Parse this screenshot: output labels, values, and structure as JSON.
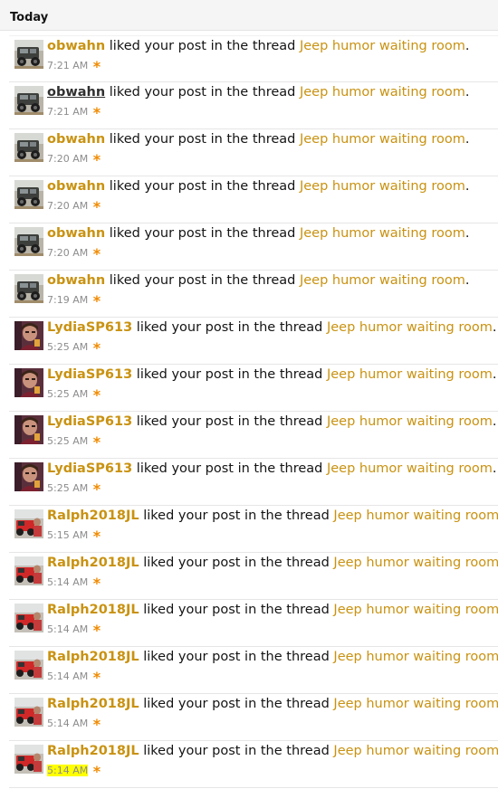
{
  "header": {
    "title": "Today"
  },
  "common": {
    "action_text": " liked your post in the thread ",
    "thread_title": "Jeep humor waiting room",
    "period": ".",
    "unread_marker": "*"
  },
  "alerts": [
    {
      "user": "obwahn",
      "time": "7:21 AM",
      "avatar": "truck-avatar",
      "hovered": false,
      "highlighted": false
    },
    {
      "user": "obwahn",
      "time": "7:21 AM",
      "avatar": "truck-avatar",
      "hovered": true,
      "highlighted": false
    },
    {
      "user": "obwahn",
      "time": "7:20 AM",
      "avatar": "truck-avatar",
      "hovered": false,
      "highlighted": false
    },
    {
      "user": "obwahn",
      "time": "7:20 AM",
      "avatar": "truck-avatar",
      "hovered": false,
      "highlighted": false
    },
    {
      "user": "obwahn",
      "time": "7:20 AM",
      "avatar": "truck-avatar",
      "hovered": false,
      "highlighted": false
    },
    {
      "user": "obwahn",
      "time": "7:19 AM",
      "avatar": "truck-avatar",
      "hovered": false,
      "highlighted": false
    },
    {
      "user": "LydiaSP613",
      "time": "5:25 AM",
      "avatar": "person-avatar",
      "hovered": false,
      "highlighted": false
    },
    {
      "user": "LydiaSP613",
      "time": "5:25 AM",
      "avatar": "person-avatar",
      "hovered": false,
      "highlighted": false
    },
    {
      "user": "LydiaSP613",
      "time": "5:25 AM",
      "avatar": "person-avatar",
      "hovered": false,
      "highlighted": false
    },
    {
      "user": "LydiaSP613",
      "time": "5:25 AM",
      "avatar": "person-avatar",
      "hovered": false,
      "highlighted": false
    },
    {
      "user": "Ralph2018JL",
      "time": "5:15 AM",
      "avatar": "jeep-avatar",
      "hovered": false,
      "highlighted": false
    },
    {
      "user": "Ralph2018JL",
      "time": "5:14 AM",
      "avatar": "jeep-avatar",
      "hovered": false,
      "highlighted": false
    },
    {
      "user": "Ralph2018JL",
      "time": "5:14 AM",
      "avatar": "jeep-avatar",
      "hovered": false,
      "highlighted": false
    },
    {
      "user": "Ralph2018JL",
      "time": "5:14 AM",
      "avatar": "jeep-avatar",
      "hovered": false,
      "highlighted": false
    },
    {
      "user": "Ralph2018JL",
      "time": "5:14 AM",
      "avatar": "jeep-avatar",
      "hovered": false,
      "highlighted": false
    },
    {
      "user": "Ralph2018JL",
      "time": "5:14 AM",
      "avatar": "jeep-avatar",
      "hovered": false,
      "highlighted": true
    }
  ],
  "colors": {
    "link": "#c99211",
    "unread": "#f08a00",
    "time": "#8c8c8c",
    "highlight": "#ffff00"
  }
}
